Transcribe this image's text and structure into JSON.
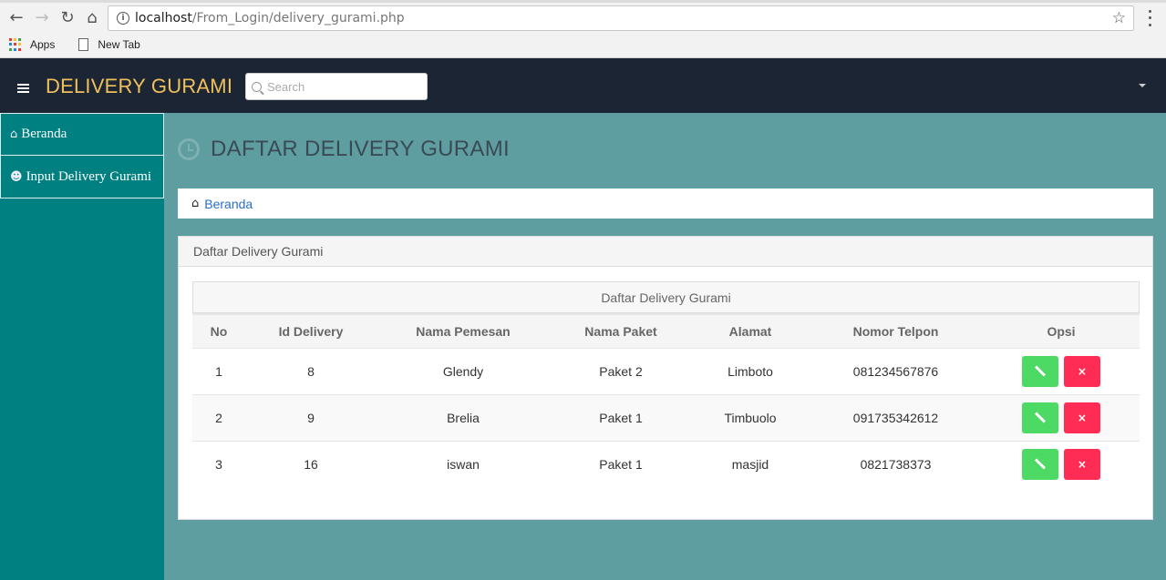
{
  "browser": {
    "url_host": "localhost",
    "url_path": "/From_Login/delivery_gurami.php",
    "bookmarks": [
      "Apps",
      "New Tab"
    ]
  },
  "navbar": {
    "brand": "DELIVERY GURAMI",
    "search_placeholder": "Search"
  },
  "sidebar": {
    "items": [
      {
        "label": "Beranda",
        "icon": "home-icon"
      },
      {
        "label": "Input Delivery Gurami",
        "icon": "user-icon"
      }
    ]
  },
  "main": {
    "title": "DAFTAR DELIVERY GURAMI",
    "title_icon": "clock-icon",
    "breadcrumb": "Beranda",
    "panel_heading": "Daftar Delivery Gurami",
    "table_caption": "Daftar Delivery Gurami",
    "columns": [
      "No",
      "Id Delivery",
      "Nama Pemesan",
      "Nama Paket",
      "Alamat",
      "Nomor Telpon",
      "Opsi"
    ],
    "rows": [
      [
        "1",
        "8",
        "Glendy",
        "Paket 2",
        "Limboto",
        "081234567876"
      ],
      [
        "2",
        "9",
        "Brelia",
        "Paket 1",
        "Timbuolo",
        "091735342612"
      ],
      [
        "3",
        "16",
        "iswan",
        "Paket 1",
        "masjid",
        "0821738373"
      ]
    ],
    "delete_label": "×"
  },
  "colors": {
    "navbar_bg": "#1b2533",
    "brand": "#f0c05a",
    "sidebar_bg": "#008080",
    "content_bg": "#5f9ea0",
    "edit_button": "#4cd964",
    "delete_button": "#ff2d55",
    "link": "#2a6fc9"
  }
}
